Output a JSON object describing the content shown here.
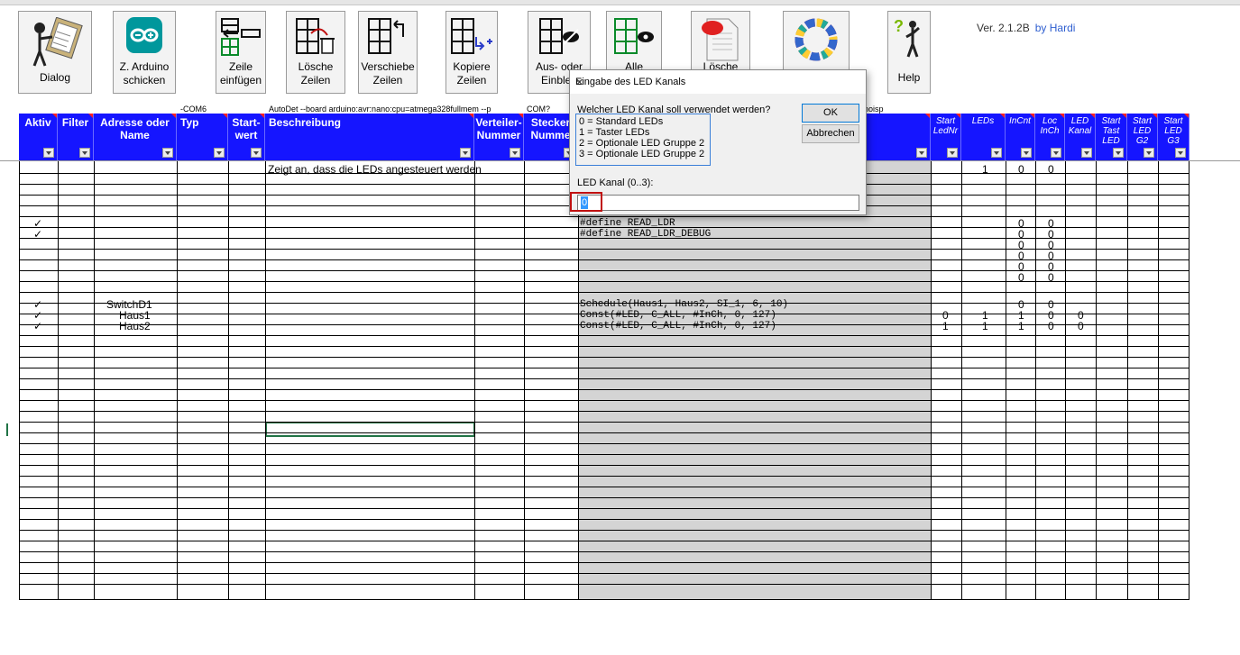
{
  "ribbon": {
    "buttons": [
      {
        "id": "dialog",
        "lines": [
          "Dialog"
        ]
      },
      {
        "id": "arduino",
        "lines": [
          "Z. Arduino",
          "schicken"
        ]
      },
      {
        "id": "insert",
        "lines": [
          "Zeile",
          "einfügen"
        ]
      },
      {
        "id": "delete",
        "lines": [
          "Lösche",
          "Zeilen"
        ]
      },
      {
        "id": "move",
        "lines": [
          "Verschiebe",
          "Zeilen"
        ]
      },
      {
        "id": "copy",
        "lines": [
          "Kopiere",
          "Zeilen"
        ]
      },
      {
        "id": "toggle",
        "lines": [
          "Aus- oder",
          "Einblen"
        ]
      },
      {
        "id": "all",
        "lines": [
          "Alle",
          ""
        ]
      },
      {
        "id": "clear",
        "lines": [
          "Lösche",
          ""
        ]
      },
      {
        "id": "colors",
        "lines": [
          "",
          ""
        ]
      },
      {
        "id": "help",
        "lines": [
          "Help"
        ]
      }
    ],
    "version": "Ver. 2.1.2B",
    "by": "by Hardi"
  },
  "info_row": {
    "com": "-COM6",
    "autodet": "AutoDet --board arduino:avr:nano:cpu=atmega328fullmem --p",
    "com2": "COM?",
    "inoisp": "inoisp"
  },
  "headers": {
    "aktiv": "Aktiv",
    "filter": "Filter",
    "adresse": "Adresse oder Name",
    "typ": "Typ",
    "startwert": "Start- wert",
    "beschreibung": "Beschreibung",
    "verteiler": "Verteiler- Nummer",
    "stecker": "Stecker Numme",
    "start_lednr": "Start LedNr",
    "leds": "LEDs",
    "incnt": "InCnt",
    "loc_inch": "Loc InCh",
    "led_kanal": "LED Kanal",
    "start_tast": "Start Tast LED",
    "start_g2": "Start LED G2",
    "start_g3": "Start LED G3"
  },
  "rows": {
    "r0": {
      "beschreibung": "Zeigt an, dass die LEDs angesteuert werden",
      "leds": "1",
      "incnt": "0",
      "loc": "0"
    },
    "r5": {
      "aktiv": "✓",
      "macro": "#define READ_LDR",
      "incnt": "0",
      "loc": "0"
    },
    "r6": {
      "aktiv": "✓",
      "macro": "#define READ_LDR_DEBUG",
      "incnt": "0",
      "loc": "0"
    },
    "r7": {
      "incnt": "0",
      "loc": "0"
    },
    "r8": {
      "incnt": "0",
      "loc": "0"
    },
    "r9": {
      "incnt": "0",
      "loc": "0"
    },
    "r10": {
      "incnt": "0",
      "loc": "0"
    },
    "r11": {
      "aktiv": "✓",
      "name": "SwitchD1",
      "macro": "Schedule(Haus1, Haus2, SI_1, 6, 10)",
      "incnt": "0",
      "loc": "0"
    },
    "r12": {
      "aktiv": "✓",
      "name": "Haus1",
      "macro": "Const(#LED, C_ALL, #InCh, 0, 127)",
      "start": "0",
      "leds": "1",
      "incnt": "1",
      "loc": "0",
      "kanal": "0"
    },
    "r13": {
      "aktiv": "✓",
      "name": "Haus2",
      "macro": "Const(#LED, C_ALL, #InCh, 0, 127)",
      "start": "1",
      "leds": "1",
      "incnt": "1",
      "loc": "0",
      "kanal": "0"
    }
  },
  "dialog": {
    "title": "Eingabe des LED Kanals",
    "question": "Welcher LED Kanal soll verwendet werden?",
    "options": [
      "0 = Standard LEDs",
      "1 = Taster LEDs",
      "2 = Optionale LED Gruppe 2",
      "3 = Optionale LED Gruppe 2"
    ],
    "ok": "OK",
    "cancel": "Abbrechen",
    "input_label": "LED Kanal (0..3):",
    "input_value": "0",
    "close": "✕"
  },
  "colors": {
    "header_blue": "#1515ff",
    "sheet_gray": "#d4d4d4",
    "excel_green": "#217346"
  }
}
